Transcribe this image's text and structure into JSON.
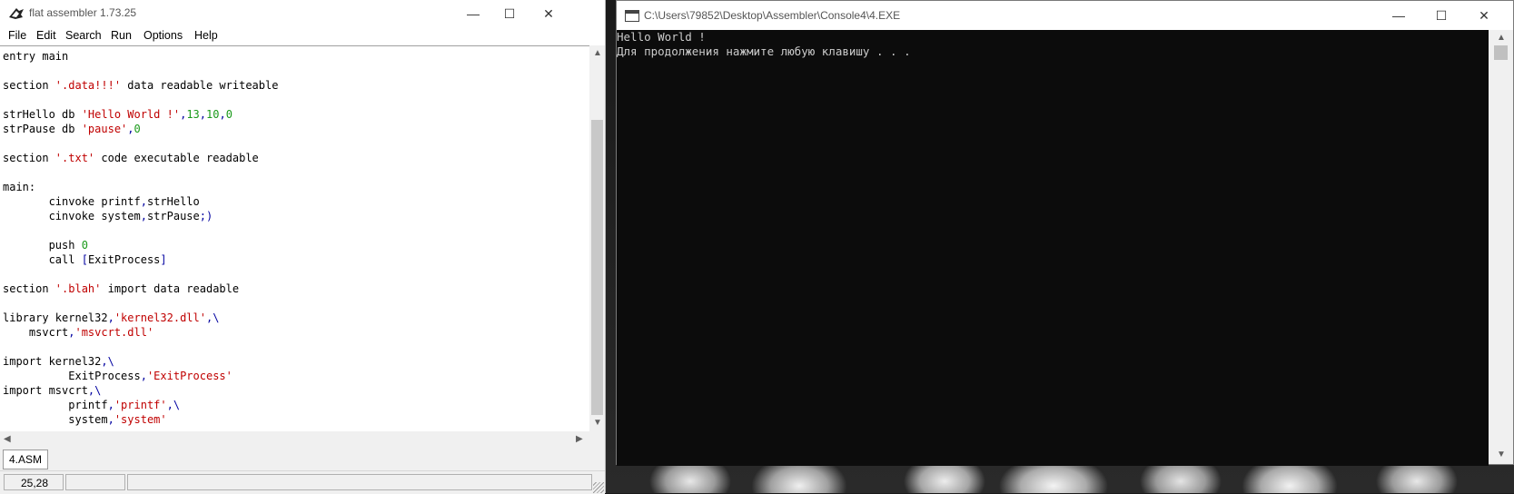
{
  "fasm": {
    "title": "flat assembler 1.73.25",
    "menu": [
      "File",
      "Edit",
      "Search",
      "Run",
      "Options",
      "Help"
    ],
    "code_lines": [
      [
        {
          "t": "entry main",
          "c": ""
        }
      ],
      [],
      [
        {
          "t": "section ",
          "c": ""
        },
        {
          "t": "'.data!!!'",
          "c": "str"
        },
        {
          "t": " data readable writeable",
          "c": ""
        }
      ],
      [],
      [
        {
          "t": "strHello db ",
          "c": ""
        },
        {
          "t": "'Hello World !'",
          "c": "str"
        },
        {
          "t": ",",
          "c": "sym"
        },
        {
          "t": "13",
          "c": "num"
        },
        {
          "t": ",",
          "c": "sym"
        },
        {
          "t": "10",
          "c": "num"
        },
        {
          "t": ",",
          "c": "sym"
        },
        {
          "t": "0",
          "c": "num"
        }
      ],
      [
        {
          "t": "strPause db ",
          "c": ""
        },
        {
          "t": "'pause'",
          "c": "str"
        },
        {
          "t": ",",
          "c": "sym"
        },
        {
          "t": "0",
          "c": "num"
        }
      ],
      [],
      [
        {
          "t": "section ",
          "c": ""
        },
        {
          "t": "'.txt'",
          "c": "str"
        },
        {
          "t": " code executable readable",
          "c": ""
        }
      ],
      [],
      [
        {
          "t": "main:",
          "c": ""
        }
      ],
      [
        {
          "t": "       cinvoke printf",
          "c": ""
        },
        {
          "t": ",",
          "c": "sym"
        },
        {
          "t": "strHello",
          "c": ""
        }
      ],
      [
        {
          "t": "       cinvoke system",
          "c": ""
        },
        {
          "t": ",",
          "c": "sym"
        },
        {
          "t": "strPause",
          "c": ""
        },
        {
          "t": ";)",
          "c": "sym"
        }
      ],
      [],
      [
        {
          "t": "       push ",
          "c": ""
        },
        {
          "t": "0",
          "c": "num"
        }
      ],
      [
        {
          "t": "       call ",
          "c": ""
        },
        {
          "t": "[",
          "c": "sym"
        },
        {
          "t": "ExitProcess",
          "c": ""
        },
        {
          "t": "]",
          "c": "sym"
        }
      ],
      [],
      [
        {
          "t": "section ",
          "c": ""
        },
        {
          "t": "'.blah'",
          "c": "str"
        },
        {
          "t": " import data readable",
          "c": ""
        }
      ],
      [],
      [
        {
          "t": "library kernel32",
          "c": ""
        },
        {
          "t": ",",
          "c": "sym"
        },
        {
          "t": "'kernel32.dll'",
          "c": "str"
        },
        {
          "t": ",\\",
          "c": "sym"
        }
      ],
      [
        {
          "t": "    msvcrt",
          "c": ""
        },
        {
          "t": ",",
          "c": "sym"
        },
        {
          "t": "'msvcrt.dll'",
          "c": "str"
        }
      ],
      [],
      [
        {
          "t": "import kernel32",
          "c": ""
        },
        {
          "t": ",\\",
          "c": "sym"
        }
      ],
      [
        {
          "t": "          ExitProcess",
          "c": ""
        },
        {
          "t": ",",
          "c": "sym"
        },
        {
          "t": "'ExitProcess'",
          "c": "str"
        }
      ],
      [
        {
          "t": "import msvcrt",
          "c": ""
        },
        {
          "t": ",\\",
          "c": "sym"
        }
      ],
      [
        {
          "t": "          printf",
          "c": ""
        },
        {
          "t": ",",
          "c": "sym"
        },
        {
          "t": "'printf'",
          "c": "str"
        },
        {
          "t": ",\\",
          "c": "sym"
        }
      ],
      [
        {
          "t": "          system",
          "c": ""
        },
        {
          "t": ",",
          "c": "sym"
        },
        {
          "t": "'system'",
          "c": "str"
        }
      ]
    ],
    "file_tab": "4.ASM",
    "status": {
      "cursor": "25,28",
      "cell2": "",
      "cell3": ""
    }
  },
  "console": {
    "title": "C:\\Users\\79852\\Desktop\\Assembler\\Console4\\4.EXE",
    "lines": [
      "Hello World !",
      "Для продолжения нажмите любую клавишу . . ."
    ]
  },
  "colors": {
    "string": "#c00000",
    "number": "#1a9a1a",
    "symbol": "#0000a0",
    "console_bg": "#0c0c0c",
    "console_fg": "#cccccc"
  },
  "icons": {
    "minimize": "—",
    "maximize": "☐",
    "close": "✕",
    "up": "▲",
    "down": "▼",
    "left": "◀",
    "right": "▶"
  }
}
